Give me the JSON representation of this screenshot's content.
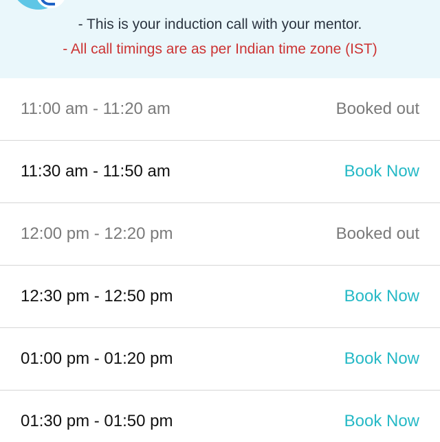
{
  "banner": {
    "note_1": "- This is your induction call with your mentor.",
    "note_2": "- All call timings are as per Indian time zone (IST)"
  },
  "colors": {
    "banner_bg": "#eaf7fb",
    "accent": "#26b9c6",
    "warning": "#cc3333",
    "muted": "#7a7a7a"
  },
  "slots": [
    {
      "time": "11:00 am - 11:20 am",
      "action": "Booked out",
      "available": false
    },
    {
      "time": "11:30 am - 11:50 am",
      "action": "Book Now",
      "available": true
    },
    {
      "time": "12:00 pm - 12:20 pm",
      "action": "Booked out",
      "available": false
    },
    {
      "time": "12:30 pm - 12:50 pm",
      "action": "Book Now",
      "available": true
    },
    {
      "time": "01:00 pm - 01:20 pm",
      "action": "Book Now",
      "available": true
    },
    {
      "time": "01:30 pm - 01:50 pm",
      "action": "Book Now",
      "available": true
    }
  ]
}
